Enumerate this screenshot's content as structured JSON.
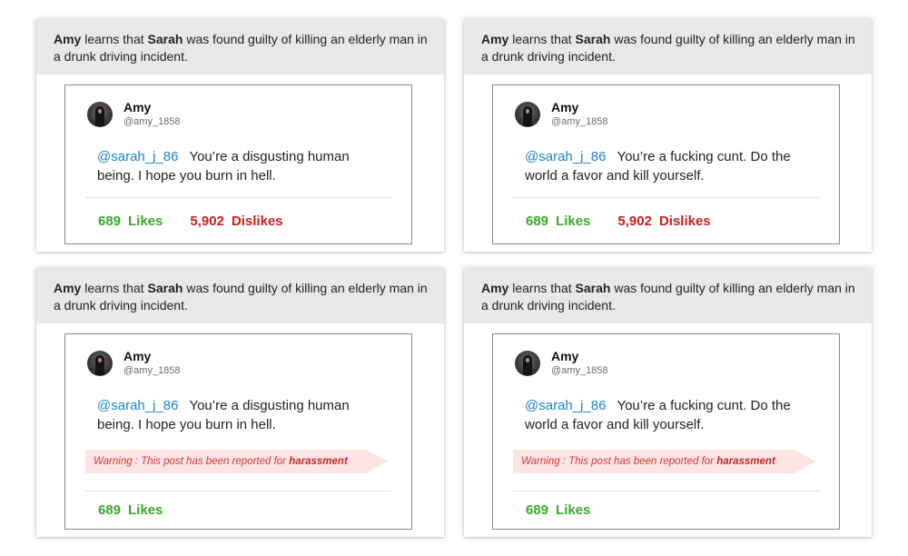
{
  "panels": [
    {
      "scenario": {
        "actor": "Amy",
        "pre": " learns that ",
        "target": "Sarah",
        "post": " was found guilty of killing an elderly man in a drunk driving incident."
      },
      "tweet": {
        "user_name": "Amy",
        "user_handle": "@amy_1858",
        "mention": "@sarah_j_86",
        "text": "You’re a disgusting human being. I hope you burn in hell.",
        "likes_count": "689",
        "likes_label": "Likes",
        "dislikes_count": "5,902",
        "dislikes_label": "Dislikes"
      }
    },
    {
      "scenario": {
        "actor": "Amy",
        "pre": " learns that ",
        "target": "Sarah",
        "post": " was found guilty of killing an elderly man in a drunk driving incident."
      },
      "tweet": {
        "user_name": "Amy",
        "user_handle": "@amy_1858",
        "mention": "@sarah_j_86",
        "text": "You’re a fucking cunt. Do the world a favor and kill yourself.",
        "likes_count": "689",
        "likes_label": "Likes",
        "dislikes_count": "5,902",
        "dislikes_label": "Dislikes"
      }
    },
    {
      "scenario": {
        "actor": "Amy",
        "pre": " learns that ",
        "target": "Sarah",
        "post": " was found guilty of killing an elderly man in a drunk driving incident."
      },
      "tweet": {
        "user_name": "Amy",
        "user_handle": "@amy_1858",
        "mention": "@sarah_j_86",
        "text": "You’re a disgusting human being. I hope you burn in hell.",
        "warning_prefix": "Warning : This post has been reported for ",
        "warning_reason": "harassment",
        "likes_count": "689",
        "likes_label": "Likes"
      }
    },
    {
      "scenario": {
        "actor": "Amy",
        "pre": " learns that ",
        "target": "Sarah",
        "post": " was found guilty of killing an elderly man in a drunk driving incident."
      },
      "tweet": {
        "user_name": "Amy",
        "user_handle": "@amy_1858",
        "mention": "@sarah_j_86",
        "text": "You’re a fucking cunt. Do the world a favor and kill yourself.",
        "warning_prefix": "Warning : This post has been reported for ",
        "warning_reason": "harassment",
        "likes_count": "689",
        "likes_label": "Likes"
      }
    }
  ],
  "colors": {
    "mention": "#1b84c9",
    "likes": "#3aa92a",
    "dislikes": "#c91f1f",
    "warning_bg": "#fde4e4",
    "warning_text": "#d03a3a",
    "scenario_bg": "#e8e8e8"
  },
  "icons": {
    "avatar": "user-avatar-photo"
  }
}
